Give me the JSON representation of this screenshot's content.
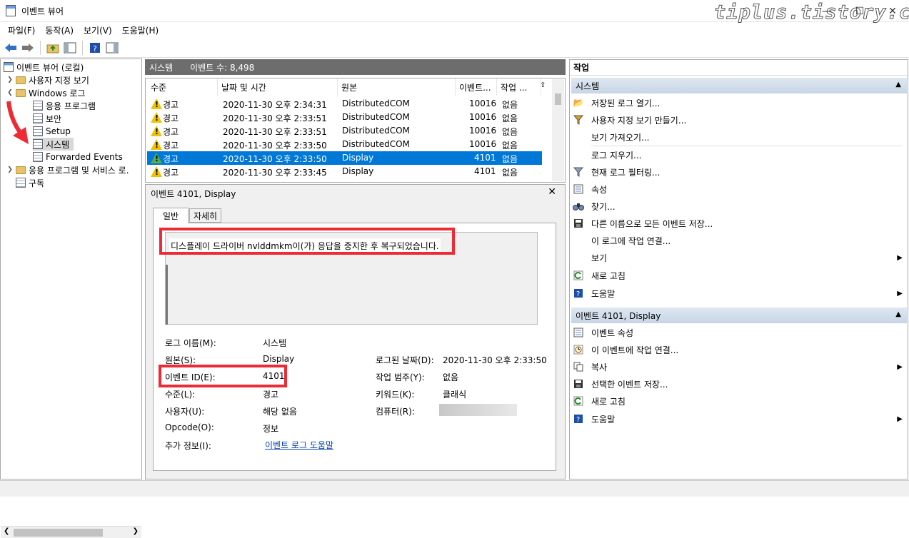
{
  "window": {
    "title": "이벤트 뷰어",
    "watermark": "tiplus.tistory.com"
  },
  "menu": [
    "파일(F)",
    "동작(A)",
    "보기(V)",
    "도움말(H)"
  ],
  "tree": [
    {
      "label": "이벤트 뷰어 (로컬)"
    },
    {
      "label": "사용자 지정 보기"
    },
    {
      "label": "Windows 로그"
    },
    {
      "label": "응용 프로그램"
    },
    {
      "label": "보안"
    },
    {
      "label": "Setup"
    },
    {
      "label": "시스템"
    },
    {
      "label": "Forwarded Events"
    },
    {
      "label": "응용 프로그램 및 서비스 로."
    },
    {
      "label": "구독"
    }
  ],
  "log_header": {
    "name": "시스템",
    "count": "이벤트 수: 8,498"
  },
  "columns": [
    "수준",
    "날짜 및 시간",
    "원본",
    "이벤트...",
    "작업 ..."
  ],
  "events": [
    {
      "level": "경고",
      "datetime": "2020-11-30 오후 2:34:31",
      "source": "DistributedCOM",
      "id": "10016",
      "task": "없음"
    },
    {
      "level": "경고",
      "datetime": "2020-11-30 오후 2:33:51",
      "source": "DistributedCOM",
      "id": "10016",
      "task": "없음"
    },
    {
      "level": "경고",
      "datetime": "2020-11-30 오후 2:33:51",
      "source": "DistributedCOM",
      "id": "10016",
      "task": "없음"
    },
    {
      "level": "경고",
      "datetime": "2020-11-30 오후 2:33:50",
      "source": "DistributedCOM",
      "id": "10016",
      "task": "없음"
    },
    {
      "level": "경고",
      "datetime": "2020-11-30 오후 2:33:50",
      "source": "Display",
      "id": "4101",
      "task": "없음"
    },
    {
      "level": "경고",
      "datetime": "2020-11-30 오후 2:33:45",
      "source": "Display",
      "id": "4101",
      "task": "없음"
    }
  ],
  "detail": {
    "title": "이벤트 4101, Display",
    "tabs": [
      "일반",
      "자세히"
    ],
    "description": "디스플레이 드라이버 nvlddmkm이(가) 응답을 중지한 후 복구되었습니다.",
    "fields": {
      "log_name_label": "로그 이름(M):",
      "log_name": "시스템",
      "source_label": "원본(S):",
      "source": "Display",
      "logged_label": "로그된 날짜(D):",
      "logged": "2020-11-30 오후 2:33:50",
      "event_id_label": "이벤트 ID(E):",
      "event_id": "4101",
      "task_label": "작업 범주(Y):",
      "task": "없음",
      "level_label": "수준(L):",
      "level": "경고",
      "keywords_label": "키워드(K):",
      "keywords": "클래식",
      "user_label": "사용자(U):",
      "user": "해당 없음",
      "computer_label": "컴퓨터(R):",
      "opcode_label": "Opcode(O):",
      "opcode": "정보",
      "more_label": "추가 정보(I):",
      "more_link": "이벤트 로그 도움말"
    }
  },
  "actions": {
    "title": "작업",
    "section1": "시스템",
    "items1": [
      "저장된 로그 열기...",
      "사용자 지정 보기 만들기...",
      "보기 가져오기...",
      "로그 지우기...",
      "현재 로그 필터링...",
      "속성",
      "찾기...",
      "다른 이름으로 모든 이벤트 저장...",
      "이 로그에 작업 연결...",
      "보기",
      "새로 고침",
      "도움말"
    ],
    "section2": "이벤트 4101, Display",
    "items2": [
      "이벤트 속성",
      "이 이벤트에 작업 연결...",
      "복사",
      "선택한 이벤트 저장...",
      "새로 고침",
      "도움말"
    ]
  }
}
